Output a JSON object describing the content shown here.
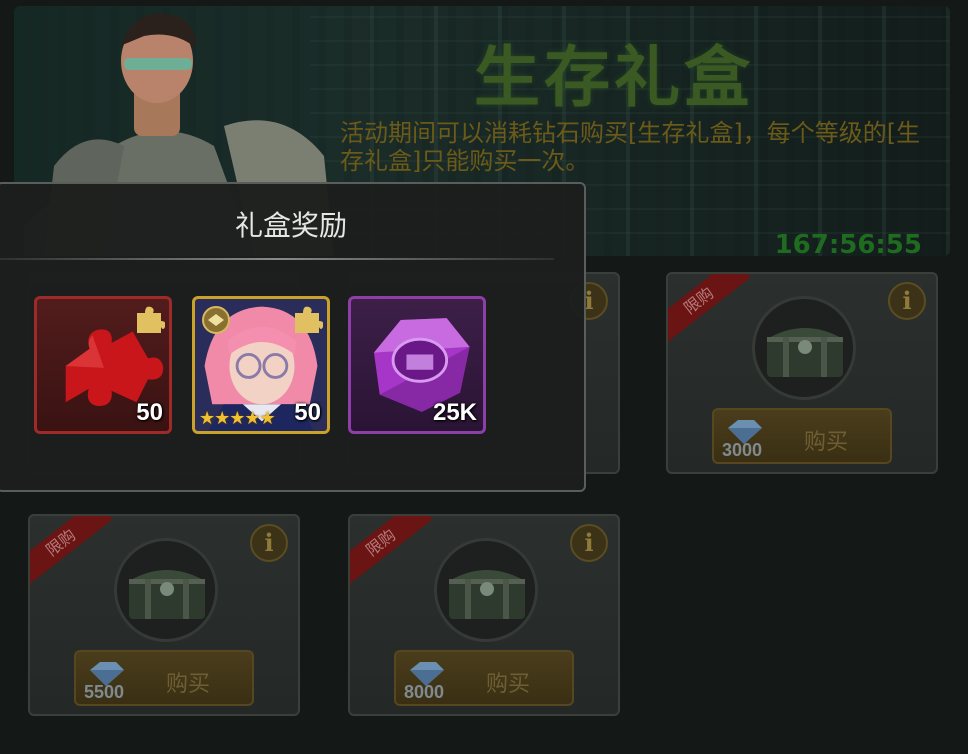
{
  "banner": {
    "title": "生存礼盒",
    "description": "活动期间可以消耗钻石购买[生存礼盒]，每个等级的[生存礼盒]只能购买一次。",
    "timer": "167:56:55"
  },
  "modal": {
    "title": "礼盒奖励",
    "rewards": [
      {
        "icon": "puzzle-piece-icon",
        "quantity": "50"
      },
      {
        "icon": "hero-portrait-icon",
        "quantity": "50",
        "stars": "★★★★★"
      },
      {
        "icon": "fist-gem-icon",
        "quantity": "25K"
      }
    ]
  },
  "shop": {
    "limit_label": "限购",
    "buy_label": "购买",
    "cards": [
      {
        "price": "3000"
      },
      {
        "price": "5500"
      },
      {
        "price": "8000"
      }
    ]
  },
  "colors": {
    "title_green": "#3b5a23",
    "timer_green": "#1f6b1f",
    "ribbon_red": "#6b1414",
    "reward_red_border": "#9e2a2a",
    "reward_gold_border": "#c9a227",
    "reward_purple_border": "#8c3fa6"
  }
}
